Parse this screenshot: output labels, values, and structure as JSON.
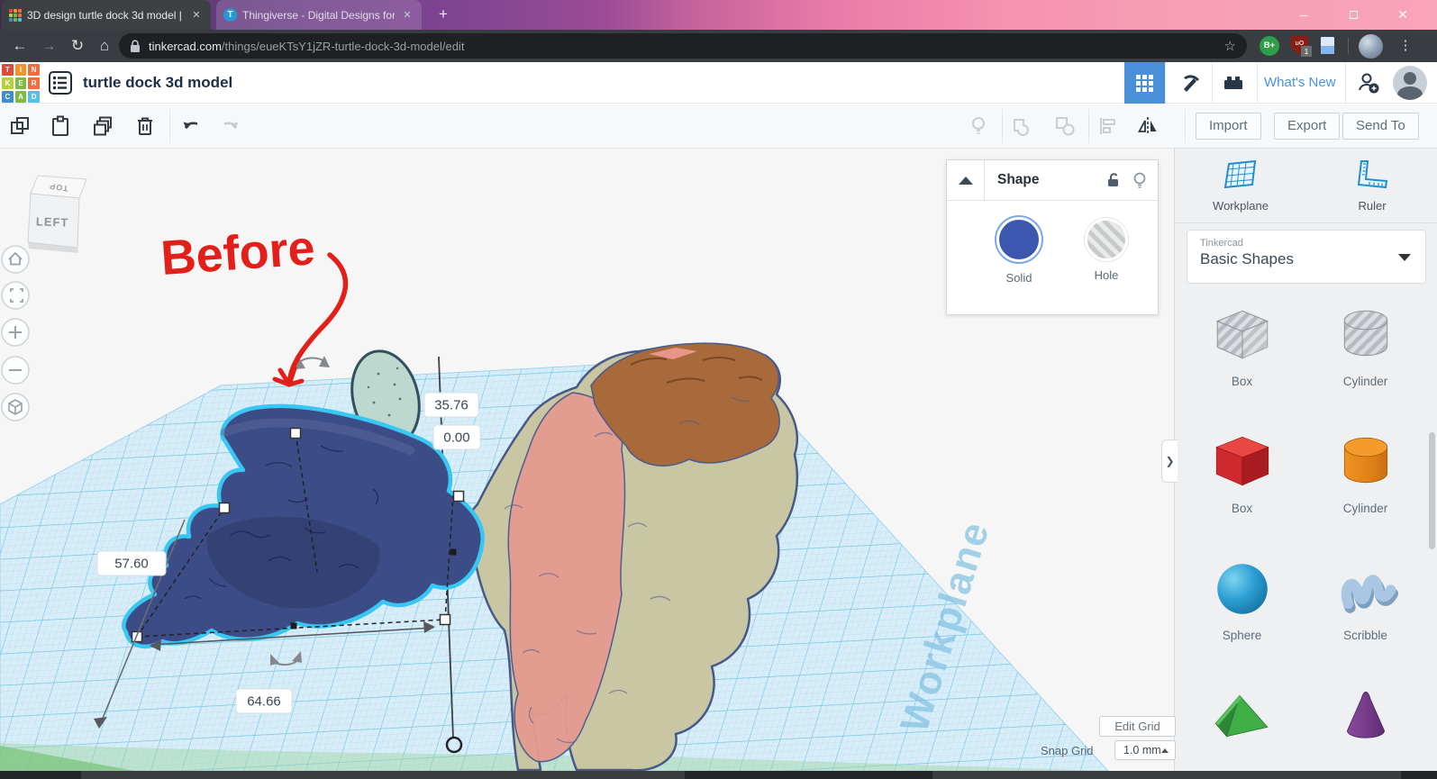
{
  "browser": {
    "tabs": [
      {
        "title": "3D design turtle dock 3d model |",
        "favicon": "tinkercad-grid-icon"
      },
      {
        "title": "Thingiverse - Digital Designs for",
        "favicon": "thingiverse-icon"
      }
    ],
    "url_domain": "tinkercad.com",
    "url_path": "/things/eueKTsY1jZR-turtle-dock-3d-model/edit",
    "extensions": {
      "b_badge": "B+",
      "ublock_text": "uO",
      "ublock_badge": "1"
    }
  },
  "header": {
    "title": "turtle dock 3d model",
    "whats_new": "What's New"
  },
  "toolbar": {
    "import_label": "Import",
    "export_label": "Export",
    "send_to_label": "Send To"
  },
  "shape_panel": {
    "title": "Shape",
    "solid_label": "Solid",
    "hole_label": "Hole"
  },
  "sidebar": {
    "workplane_label": "Workplane",
    "ruler_label": "Ruler",
    "library_brand": "Tinkercad",
    "library_name": "Basic Shapes",
    "shapes": [
      {
        "label": "Box",
        "variant": "hole-box"
      },
      {
        "label": "Cylinder",
        "variant": "hole-cylinder"
      },
      {
        "label": "Box",
        "variant": "solid-box"
      },
      {
        "label": "Cylinder",
        "variant": "solid-cylinder"
      },
      {
        "label": "Sphere",
        "variant": "sphere"
      },
      {
        "label": "Scribble",
        "variant": "scribble"
      },
      {
        "variant": "roof"
      },
      {
        "variant": "cone"
      }
    ]
  },
  "viewport": {
    "view_cube": {
      "front": "LEFT",
      "top": "TOP"
    },
    "annotation": "Before",
    "watermark": "Workplane",
    "dimensions": {
      "height": "35.76",
      "elevation": "0.00",
      "width": "57.60",
      "depth": "64.66"
    }
  },
  "grid_controls": {
    "edit_grid_label": "Edit Grid",
    "snap_grid_label": "Snap Grid",
    "snap_value": "1.0 mm"
  },
  "colors": {
    "accent_blue": "#4a90d9",
    "selection_cyan": "#38c6f2",
    "solid_swatch": "#3d56ae",
    "model_blue": "#3c4c86",
    "model_tan": "#c9c6a3",
    "model_salmon": "#e39b90",
    "model_brown": "#a8693b",
    "annotation_red": "#e31f1a"
  }
}
